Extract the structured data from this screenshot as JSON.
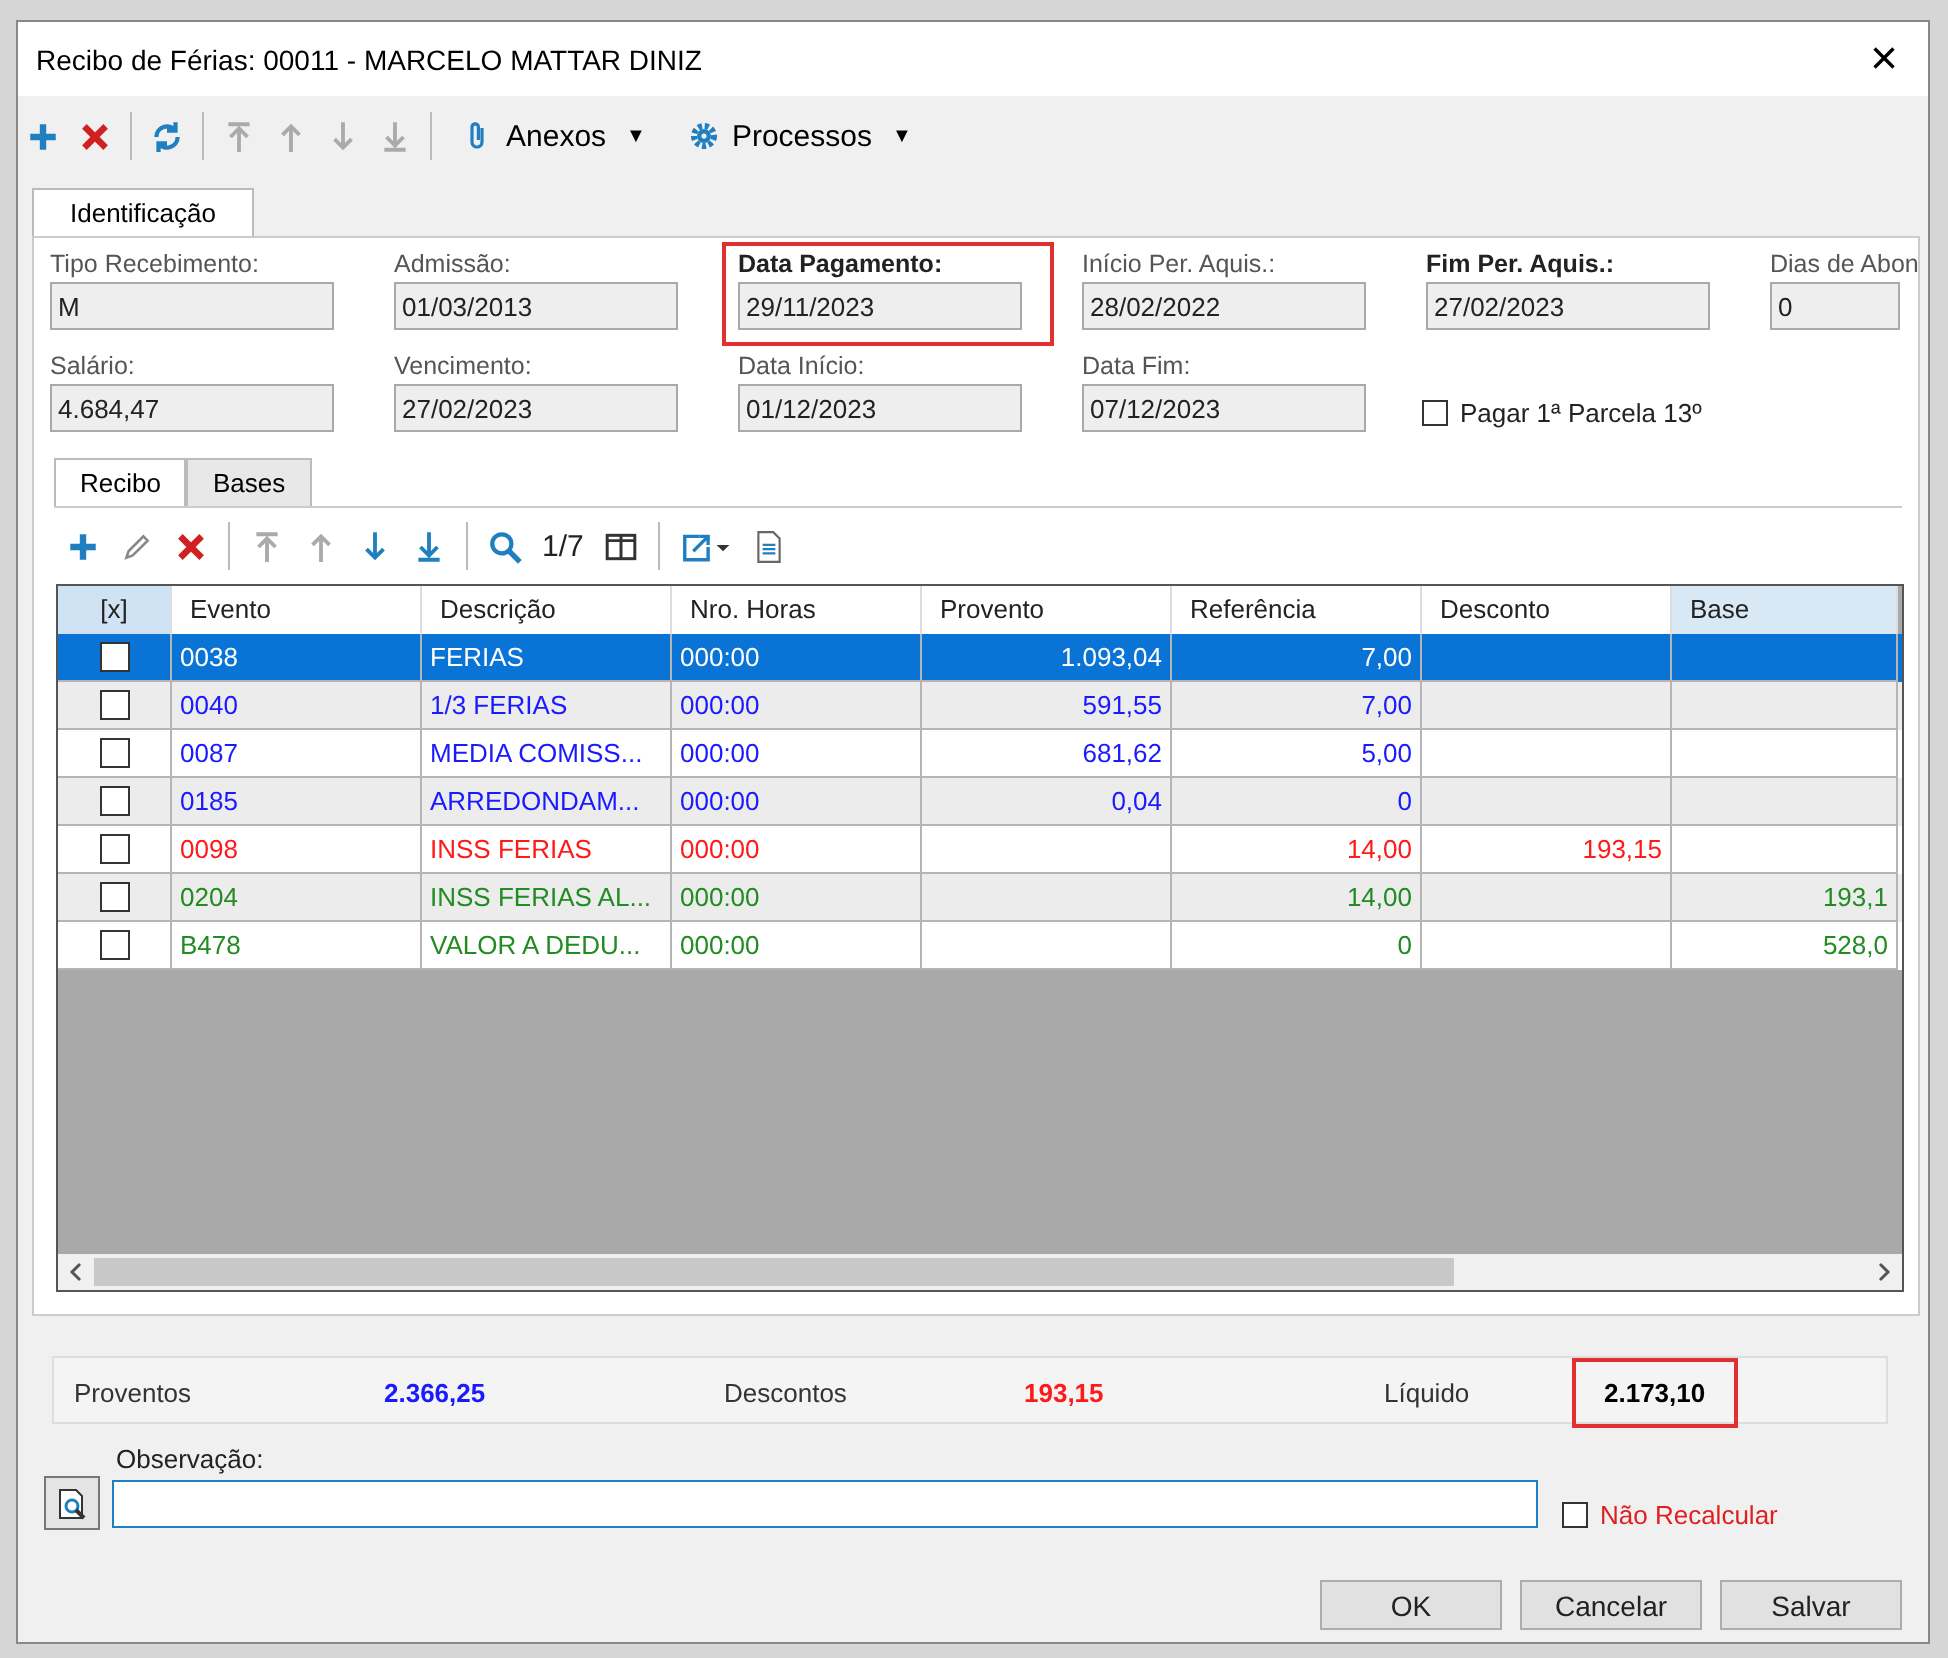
{
  "window": {
    "title": "Recibo de Férias: 00011 - MARCELO MATTAR DINIZ",
    "close": "×"
  },
  "toolbar": {
    "menus": [
      {
        "label": "Anexos",
        "caret": "▼"
      },
      {
        "label": "Processos",
        "caret": "▼"
      }
    ]
  },
  "tabs": [
    {
      "label": "Identificação",
      "selected": true
    }
  ],
  "fields": [
    {
      "label": "Tipo Recebimento:",
      "value": "M",
      "bold": false,
      "highlighted": false
    },
    {
      "label": "Admissão:",
      "value": "01/03/2013",
      "bold": false,
      "highlighted": false
    },
    {
      "label": "Data Pagamento:",
      "value": "29/11/2023",
      "bold": true,
      "highlighted": true
    },
    {
      "label": "Início Per. Aquis.:",
      "value": "28/02/2022",
      "bold": false,
      "highlighted": false
    },
    {
      "label": "Fim Per. Aquis.:",
      "value": "27/02/2023",
      "bold": true,
      "highlighted": false
    },
    {
      "label": "Dias de Abon",
      "value": "0",
      "bold": false,
      "highlighted": false
    },
    {
      "label": "Salário:",
      "value": "4.684,47",
      "bold": false,
      "highlighted": false
    },
    {
      "label": "Vencimento:",
      "value": "27/02/2023",
      "bold": false,
      "highlighted": false
    },
    {
      "label": "Data Início:",
      "value": "01/12/2023",
      "bold": false,
      "highlighted": false
    },
    {
      "label": "Data Fim:",
      "value": "07/12/2023",
      "bold": false,
      "highlighted": false
    }
  ],
  "pagar_parcela": {
    "label": "Pagar 1ª Parcela 13º",
    "checked": false
  },
  "inner_tabs": [
    {
      "label": "Recibo",
      "selected": true
    },
    {
      "label": "Bases",
      "selected": false
    }
  ],
  "grid_toolbar": {
    "record_count": "1/7"
  },
  "table": {
    "check_column": "[x]",
    "columns": [
      "Evento",
      "Descrição",
      "Nro. Horas",
      "Provento",
      "Referência",
      "Desconto",
      "Base"
    ],
    "rows": [
      {
        "checked": false,
        "selected": true,
        "cells": [
          "0038",
          "FERIAS",
          "000:00",
          "1.093,04",
          "7,00",
          "",
          ""
        ]
      },
      {
        "checked": false,
        "selected": false,
        "color": "#1a1aff",
        "cells": [
          "0040",
          "1/3 FERIAS",
          "000:00",
          "591,55",
          "7,00",
          "",
          ""
        ]
      },
      {
        "checked": false,
        "selected": false,
        "color": "#1a1aff",
        "cells": [
          "0087",
          "MEDIA COMISS...",
          "000:00",
          "681,62",
          "5,00",
          "",
          ""
        ]
      },
      {
        "checked": false,
        "selected": false,
        "color": "#1a1aff",
        "cells": [
          "0185",
          "ARREDONDAM...",
          "000:00",
          "0,04",
          "0",
          "",
          ""
        ]
      },
      {
        "checked": false,
        "selected": false,
        "color": "#ff1a1a",
        "cells": [
          "0098",
          "INSS FERIAS",
          "000:00",
          "",
          "14,00",
          "193,15",
          ""
        ]
      },
      {
        "checked": false,
        "selected": false,
        "color": "#228b22",
        "cells": [
          "0204",
          "INSS FERIAS AL...",
          "000:00",
          "",
          "14,00",
          "",
          "193,1"
        ]
      },
      {
        "checked": false,
        "selected": false,
        "color": "#228b22",
        "cells": [
          "B478",
          "VALOR A DEDU...",
          "000:00",
          "",
          "0",
          "",
          "528,0"
        ]
      }
    ]
  },
  "totals": [
    {
      "label": "Proventos",
      "value": "2.366,25",
      "color": "#1a1aff",
      "highlighted": false
    },
    {
      "label": "Descontos",
      "value": "193,15",
      "color": "#ff1a1a",
      "highlighted": false
    },
    {
      "label": "Líquido",
      "value": "2.173,10",
      "color": "#000000",
      "highlighted": true
    }
  ],
  "observacao": {
    "label": "Observação:"
  },
  "nao_recalcular": {
    "label": "Não Recalcular",
    "checked": false
  },
  "buttons": [
    {
      "label": "OK",
      "disabled": false
    },
    {
      "label": "Cancelar",
      "disabled": false
    },
    {
      "label": "Salvar",
      "disabled": false
    }
  ]
}
